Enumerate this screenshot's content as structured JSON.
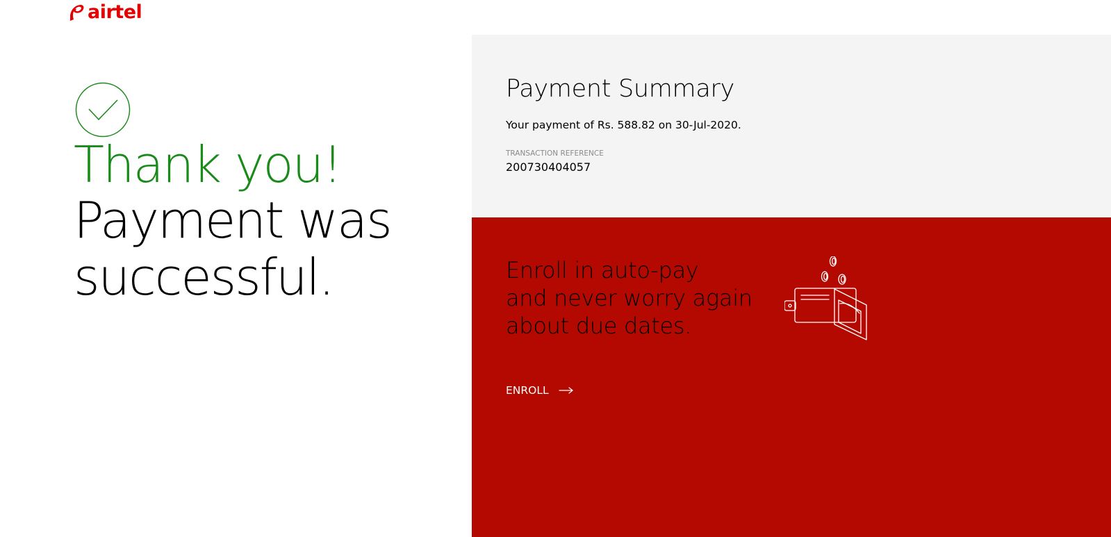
{
  "colors": {
    "brand_red": "#e40000",
    "success_green": "#1a8a1a",
    "summary_bg": "#f4f4f4",
    "enroll_bg": "#b30900",
    "text_dark": "#000000",
    "text_muted": "#8a8a8a",
    "text_light": "#ffffff"
  },
  "header": {
    "logo_text": "airtel",
    "logo_icon": "airtel-swirl-icon"
  },
  "confirmation": {
    "icon": "checkmark-circle-icon",
    "headline": "Thank you!",
    "message_line1": "Payment was",
    "message_line2": "successful."
  },
  "summary": {
    "title": "Payment Summary",
    "text": "Your payment of Rs. 588.82 on 30-Jul-2020.",
    "reference_label": "TRANSACTION REFERENCE",
    "reference_value": "200730404057"
  },
  "enroll": {
    "heading_line1": "Enroll in auto-pay",
    "heading_line2": "and never worry again",
    "heading_line3": "about due dates.",
    "icon": "wallet-coins-icon",
    "link_label": "ENROLL",
    "link_icon": "arrow-right-icon"
  }
}
